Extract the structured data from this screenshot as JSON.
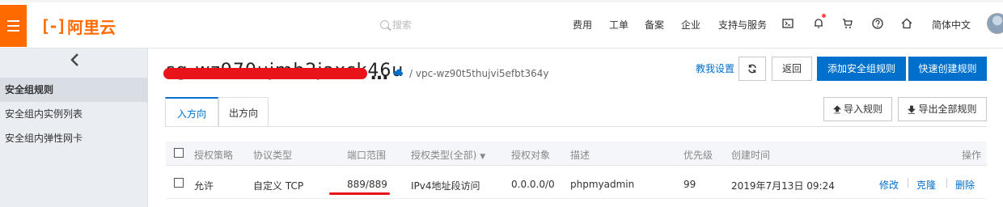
{
  "header": {
    "logo_text": "阿里云",
    "search_placeholder": "搜索",
    "nav": [
      "费用",
      "工单",
      "备案",
      "企业",
      "支持与服务"
    ],
    "language": "简体中文",
    "icons": [
      "terminal-icon",
      "bell-icon",
      "cart-icon",
      "help-icon",
      "home-icon"
    ],
    "accent_color": "#ff6a00"
  },
  "sidebar": {
    "items": [
      {
        "label": "安全组规则",
        "active": true
      },
      {
        "label": "安全组内实例列表",
        "active": false
      },
      {
        "label": "安全组内弹性网卡",
        "active": false
      }
    ]
  },
  "main": {
    "title_visible": "sg-wz970ujmh2jaxck46u",
    "ellipsis": "…",
    "vpc": "/ vpc-wz90t5thujvi5efbt364y",
    "actions": {
      "tutorial": "教我设置",
      "back": "返回",
      "add_rule": "添加安全组规则",
      "quick_create": "快速创建规则",
      "import": "导入规则",
      "export_all": "导出全部规则"
    },
    "tabs": [
      "入方向",
      "出方向"
    ],
    "table": {
      "headers": [
        "授权策略",
        "协议类型",
        "端口范围",
        "授权类型(全部)",
        "授权对象",
        "描述",
        "优先级",
        "创建时间",
        "操作"
      ],
      "rows": [
        {
          "policy": "允许",
          "protocol": "自定义 TCP",
          "port": "889/889",
          "auth_type": "IPv4地址段访问",
          "auth_object": "0.0.0.0/0",
          "description": "phpmyadmin",
          "priority": "99",
          "created": "2019年7月13日 09:24",
          "ops": [
            "修改",
            "克隆",
            "删除"
          ]
        }
      ]
    },
    "primary_color": "#0070cc",
    "annotation_color": "#e8141a"
  }
}
